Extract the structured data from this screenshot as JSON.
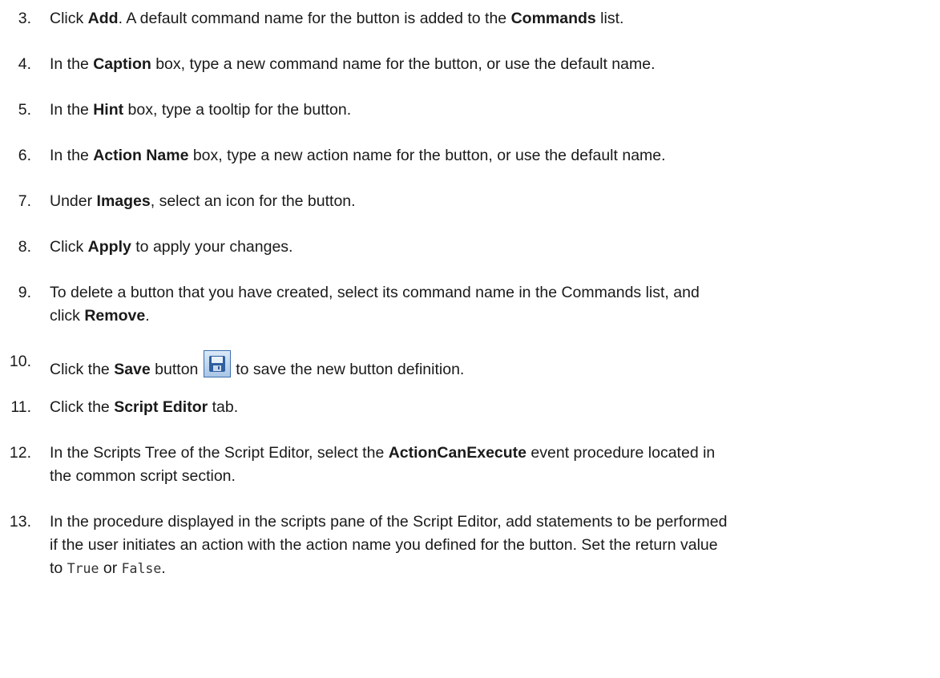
{
  "steps": [
    {
      "number": "3.",
      "parts": [
        "Click ",
        "Add",
        ". A default command name for the button is added to the ",
        "Commands",
        " list."
      ]
    },
    {
      "number": "4.",
      "parts": [
        "In the ",
        "Caption",
        " box, type a new command name for the button, or use the default name."
      ]
    },
    {
      "number": "5.",
      "parts": [
        "In the ",
        "Hint",
        " box, type a tooltip for the button."
      ]
    },
    {
      "number": "6.",
      "parts": [
        "In the ",
        "Action Name",
        " box, type a new action name for the button, or use the default name."
      ]
    },
    {
      "number": "7.",
      "parts": [
        "Under ",
        "Images",
        ", select an icon for the button."
      ]
    },
    {
      "number": "8.",
      "parts": [
        "Click ",
        "Apply",
        " to apply your changes."
      ]
    },
    {
      "number": "9.",
      "parts": [
        "To delete a button that you have created, select its command name in the Commands list, and",
        "click ",
        "Remove",
        "."
      ]
    },
    {
      "number": "10.",
      "parts": [
        "Click the ",
        "Save",
        " button ",
        " to save the new button definition."
      ]
    },
    {
      "number": "11.",
      "parts": [
        "Click the ",
        "Script Editor",
        " tab."
      ]
    },
    {
      "number": "12.",
      "parts": [
        "In the Scripts Tree of the Script Editor, select the ",
        "ActionCanExecute",
        " event procedure located in",
        "the common script section."
      ]
    },
    {
      "number": "13.",
      "parts": [
        "In the procedure displayed in the scripts pane of the Script Editor, add statements to be performed",
        "if the user initiates an action with the action name you defined for the button. Set the return value",
        "to ",
        "True",
        " or ",
        "False",
        "."
      ]
    }
  ],
  "icons": {
    "save": "floppy-disk-save-icon"
  },
  "colors": {
    "text": "#1a1a1a",
    "icon_border": "#3d6fb0",
    "icon_fill": "#a9c6e6"
  }
}
